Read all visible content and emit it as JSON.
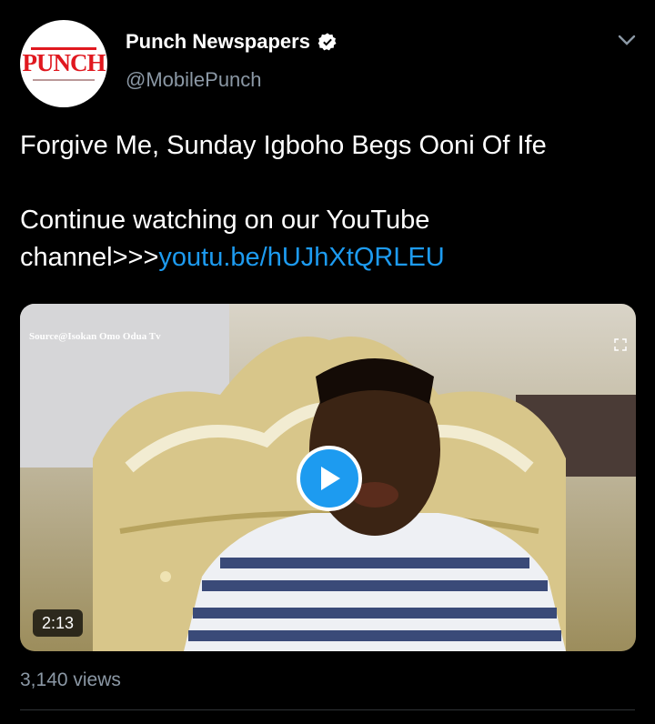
{
  "tweet": {
    "author_name": "Punch Newspapers",
    "handle": "@MobilePunch",
    "avatar_logo": "PUNCH",
    "verified_icon": "verified-badge-icon",
    "menu_icon": "chevron-down-icon",
    "text_line1": "Forgive Me, Sunday Igboho Begs Ooni Of Ife",
    "text_line2": "Continue watching on our YouTube channel>>>",
    "link_text": "youtu.be/hUJhXtQRLEU",
    "link_color": "#1d9bf0"
  },
  "media": {
    "watermark": "Source@Isokan Omo Odua Tv",
    "play_icon": "play-icon",
    "duration": "2:13",
    "play_button_color": "#1d9bf0"
  },
  "stats": {
    "views": "3,140 views"
  }
}
